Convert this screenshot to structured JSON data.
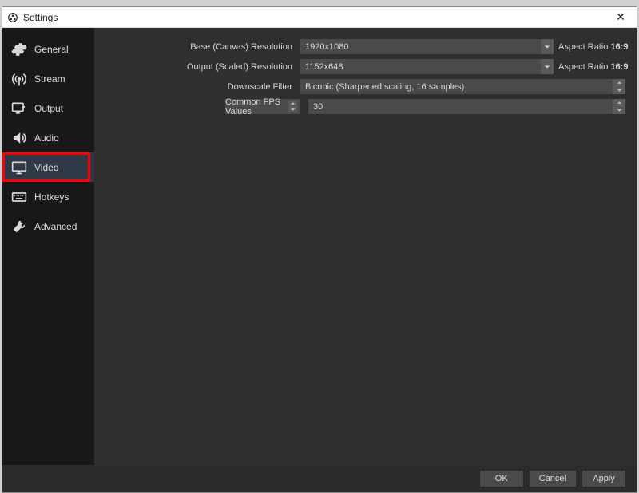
{
  "window": {
    "title": "Settings"
  },
  "sidebar": {
    "items": [
      {
        "label": "General"
      },
      {
        "label": "Stream"
      },
      {
        "label": "Output"
      },
      {
        "label": "Audio"
      },
      {
        "label": "Video"
      },
      {
        "label": "Hotkeys"
      },
      {
        "label": "Advanced"
      }
    ]
  },
  "video": {
    "base_label": "Base (Canvas) Resolution",
    "base_value": "1920x1080",
    "base_aspect_label": "Aspect Ratio",
    "base_aspect_value": "16:9",
    "output_label": "Output (Scaled) Resolution",
    "output_value": "1152x648",
    "output_aspect_label": "Aspect Ratio",
    "output_aspect_value": "16:9",
    "downscale_label": "Downscale Filter",
    "downscale_value": "Bicubic (Sharpened scaling, 16 samples)",
    "fps_type_label": "Common FPS Values",
    "fps_value": "30"
  },
  "footer": {
    "ok": "OK",
    "cancel": "Cancel",
    "apply": "Apply"
  }
}
